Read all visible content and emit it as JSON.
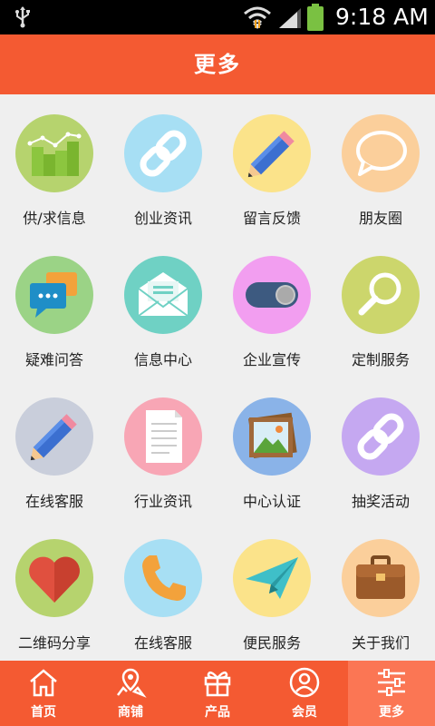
{
  "status_bar": {
    "time": "9:18 AM"
  },
  "header": {
    "title": "更多"
  },
  "menu": [
    {
      "label": "供/求信息",
      "icon": "chart-icon",
      "color": "#b6d36e"
    },
    {
      "label": "创业资讯",
      "icon": "link-icon",
      "color": "#a7dff4"
    },
    {
      "label": "留言反馈",
      "icon": "pencil-icon",
      "color": "#fbe38a"
    },
    {
      "label": "朋友圈",
      "icon": "speech-bubble-icon",
      "color": "#fbcf9b"
    },
    {
      "label": "疑难问答",
      "icon": "chat-bubbles-icon",
      "color": "#9bd386"
    },
    {
      "label": "信息中心",
      "icon": "envelope-icon",
      "color": "#6fd1c4"
    },
    {
      "label": "企业宣传",
      "icon": "toggle-icon",
      "color": "#f29ef0"
    },
    {
      "label": "定制服务",
      "icon": "magnifier-icon",
      "color": "#ccd66c"
    },
    {
      "label": "在线客服",
      "icon": "pencil-icon",
      "color": "#c9cedb"
    },
    {
      "label": "行业资讯",
      "icon": "document-icon",
      "color": "#f8a6b5"
    },
    {
      "label": "中心认证",
      "icon": "picture-icon",
      "color": "#8ab3e8"
    },
    {
      "label": "抽奖活动",
      "icon": "link-icon",
      "color": "#c5a8f1"
    },
    {
      "label": "二维码分享",
      "icon": "heart-icon",
      "color": "#b6d36e"
    },
    {
      "label": "在线客服",
      "icon": "phone-icon",
      "color": "#a7dff4"
    },
    {
      "label": "便民服务",
      "icon": "paper-plane-icon",
      "color": "#fbe38a"
    },
    {
      "label": "关于我们",
      "icon": "briefcase-icon",
      "color": "#fbcf9b"
    }
  ],
  "tabs": [
    {
      "label": "首页",
      "icon": "home-icon"
    },
    {
      "label": "商铺",
      "icon": "map-pin-icon"
    },
    {
      "label": "产品",
      "icon": "gift-icon"
    },
    {
      "label": "会员",
      "icon": "user-icon"
    },
    {
      "label": "更多",
      "icon": "sliders-icon",
      "active": true
    }
  ]
}
